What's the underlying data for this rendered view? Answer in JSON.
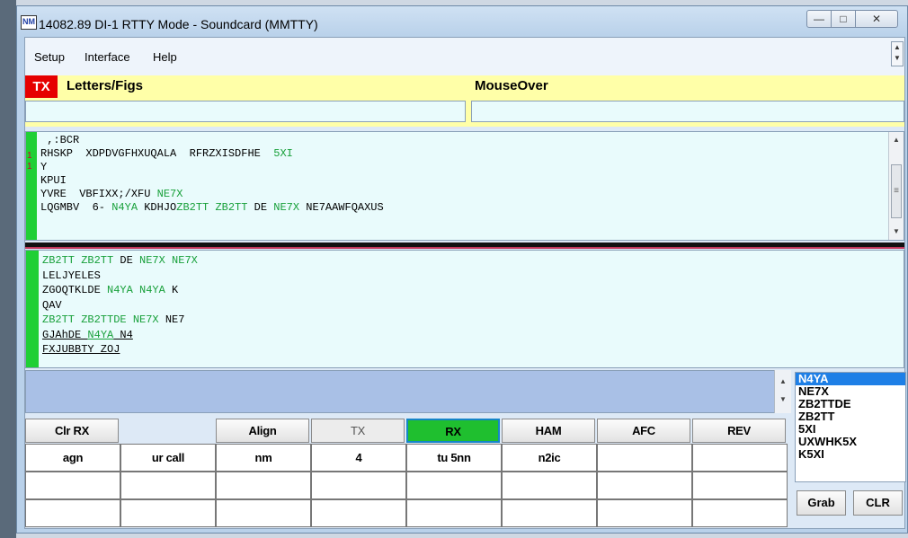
{
  "window": {
    "app_icon_text": "NM",
    "title": "14082.89  DI-1 RTTY Mode - Soundcard (MMTTY)",
    "min_glyph": "—",
    "max_glyph": "□",
    "close_glyph": "✕"
  },
  "menu": {
    "items": [
      "Setup",
      "Interface",
      "Help"
    ],
    "scroll_up": "▲",
    "scroll_down": "▼"
  },
  "status": {
    "tx_label": "TX",
    "letters_figs": "Letters/Figs",
    "mouseover": "MouseOver"
  },
  "rx_main": {
    "side_numbers": [
      "1",
      "1"
    ],
    "lines": [
      [
        {
          "t": " ,:BCR",
          "c": ""
        }
      ],
      [
        {
          "t": "RHSKP  XDPDVGFHXUQALA  RFRZXISDFHE  ",
          "c": ""
        },
        {
          "t": "5XI",
          "c": "g"
        }
      ],
      [
        {
          "t": "Y",
          "c": ""
        }
      ],
      [
        {
          "t": "KPUI",
          "c": ""
        }
      ],
      [
        {
          "t": "YVRE  VBFIXX;/XFU ",
          "c": ""
        },
        {
          "t": "NE7X",
          "c": "g"
        }
      ],
      [
        {
          "t": "LQGMBV  6- ",
          "c": ""
        },
        {
          "t": "N4YA",
          "c": "g"
        },
        {
          "t": " KDHJO",
          "c": ""
        },
        {
          "t": "ZB2TT ZB2TT",
          "c": "g"
        },
        {
          "t": " DE ",
          "c": ""
        },
        {
          "t": "NE7X",
          "c": "g"
        },
        {
          "t": " NE7AAWFQAXUS",
          "c": ""
        }
      ]
    ],
    "scroll_up": "▲",
    "scroll_down": "▼",
    "thumb_glyph": "≡"
  },
  "rx_second": {
    "lines": [
      [
        {
          "t": "ZB2TT ZB2TT",
          "c": "g"
        },
        {
          "t": " DE ",
          "c": ""
        },
        {
          "t": "NE7X NE7X",
          "c": "g"
        }
      ],
      [
        {
          "t": "LELJYELES",
          "c": ""
        }
      ],
      [
        {
          "t": "ZGOQTKLDE ",
          "c": ""
        },
        {
          "t": "N4YA N4YA",
          "c": "g"
        },
        {
          "t": " K",
          "c": ""
        }
      ],
      [
        {
          "t": "QAV",
          "c": ""
        }
      ],
      [
        {
          "t": "ZB2TT ZB2TTDE NE7X",
          "c": "g"
        },
        {
          "t": " NE7",
          "c": ""
        }
      ],
      [
        {
          "t": "GJAhDE ",
          "c": "ul"
        },
        {
          "t": "N4YA",
          "c": "g ul"
        },
        {
          "t": " N4",
          "c": "ul"
        }
      ],
      [
        {
          "t": "FXJUBBTY ZOJ",
          "c": "ul"
        }
      ]
    ]
  },
  "tx_scroll": {
    "up": "▲",
    "down": "▼"
  },
  "callsigns": [
    "N4YA",
    "NE7X",
    "ZB2TTDE",
    "ZB2TT",
    "5XI",
    "UXWHK5X",
    "K5XI"
  ],
  "buttons": {
    "clr_rx": "Clr RX",
    "align": "Align",
    "tx": "TX",
    "rx": "RX",
    "ham": "HAM",
    "afc": "AFC",
    "rev": "REV"
  },
  "macros_row1": [
    "agn",
    "ur call",
    "nm",
    "4",
    "tu 5nn",
    "n2ic",
    "",
    ""
  ],
  "macros_row2": [
    "",
    "",
    "",
    "",
    "",
    "",
    "",
    ""
  ],
  "macros_row3": [
    "",
    "",
    "",
    "",
    "",
    "",
    "",
    ""
  ],
  "side_buttons": {
    "grab": "Grab",
    "clr": "CLR"
  },
  "colors": {
    "rx_green": "#1fbf2f",
    "callsign_green": "#18a03a",
    "tx_red": "#e60000",
    "status_yellow": "#ffffa8",
    "selected_call": "#1e7fe6"
  }
}
